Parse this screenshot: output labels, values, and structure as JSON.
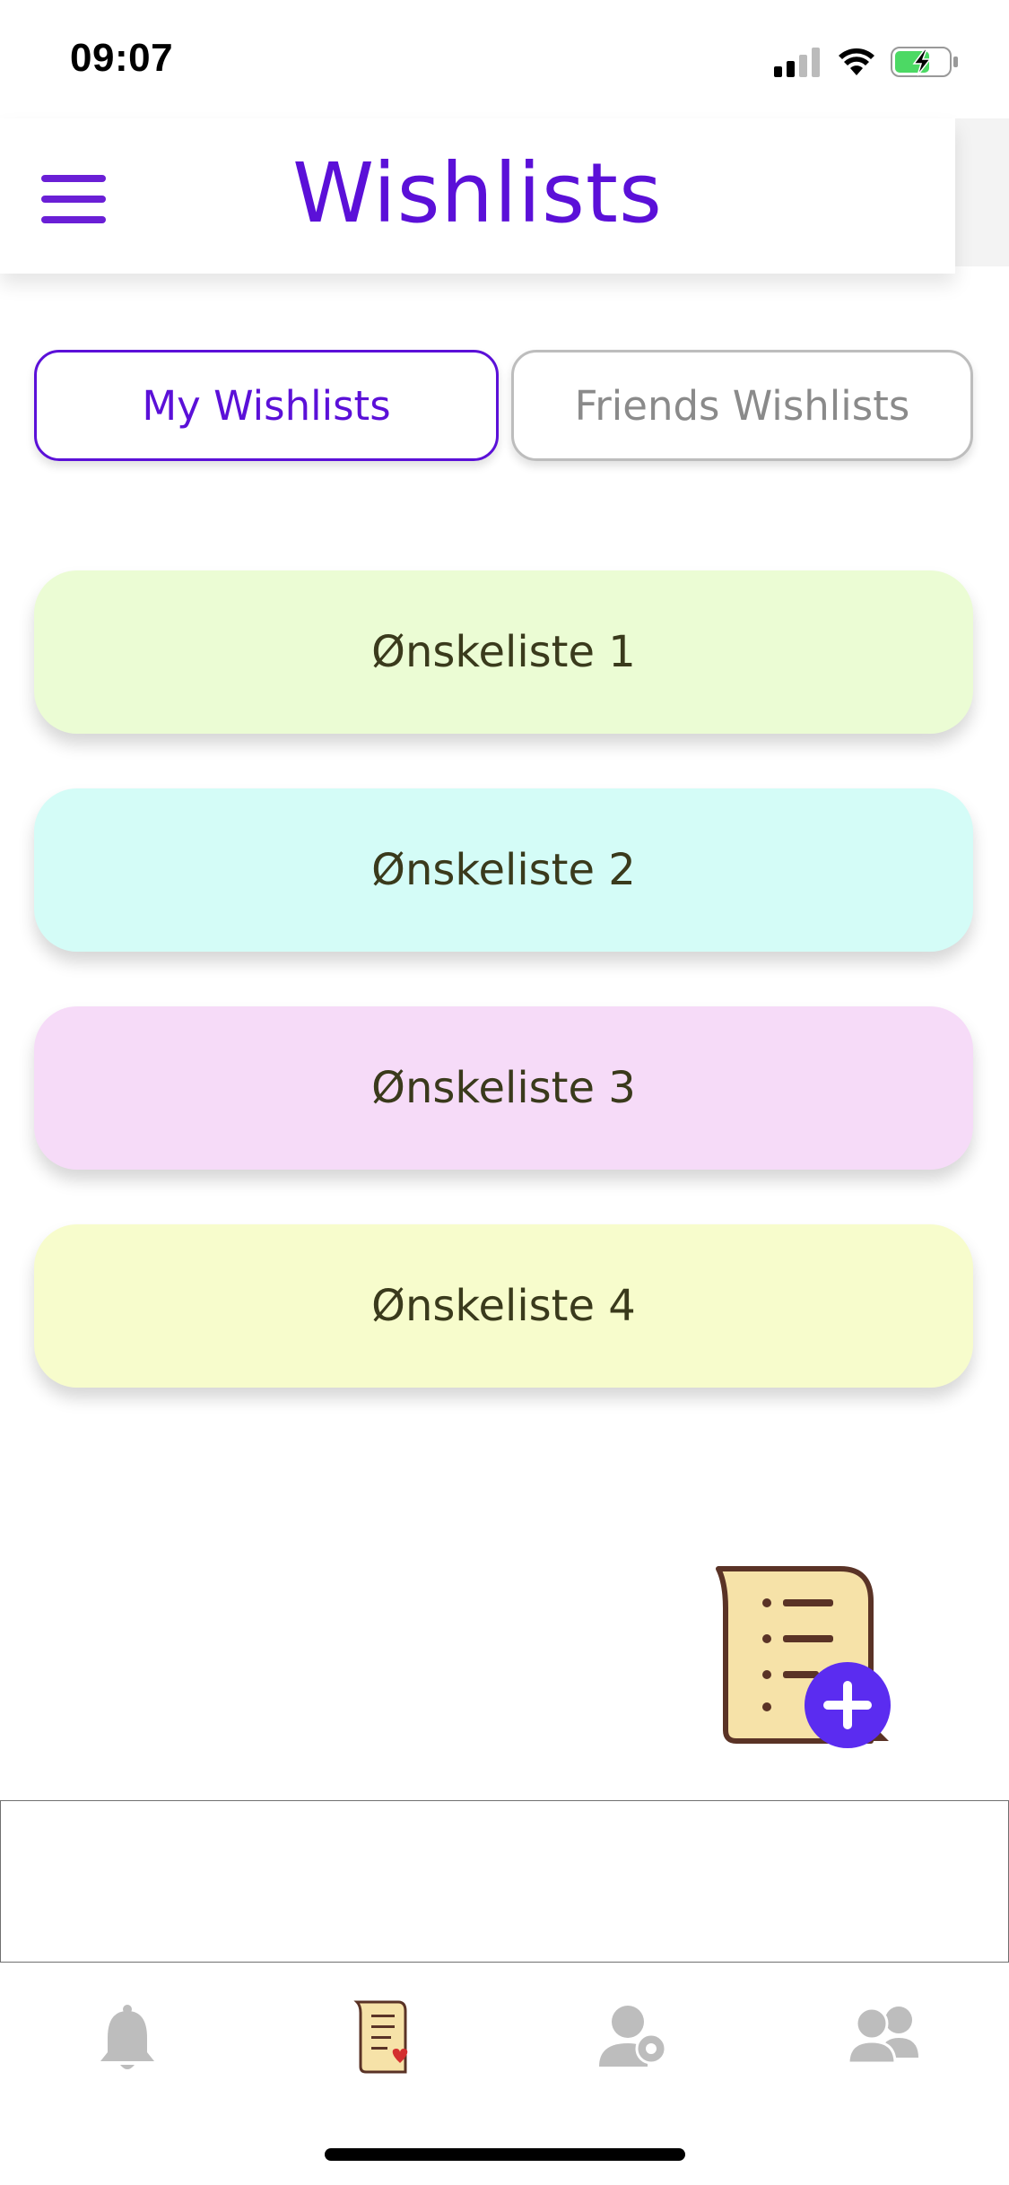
{
  "status_bar": {
    "time": "09:07"
  },
  "header": {
    "title": "Wishlists",
    "menu_icon": "hamburger-menu-icon"
  },
  "tabs": [
    {
      "label": "My Wishlists",
      "active": true
    },
    {
      "label": "Friends Wishlists",
      "active": false
    }
  ],
  "wishlists": [
    {
      "name": "Ønskeliste 1",
      "color": "#ebfcd4"
    },
    {
      "name": "Ønskeliste 2",
      "color": "#d4fcf7"
    },
    {
      "name": "Ønskeliste 3",
      "color": "#f6dbf8"
    },
    {
      "name": "Ønskeliste 4",
      "color": "#f7fccc"
    }
  ],
  "fab": {
    "icon": "scroll-add-icon"
  },
  "tab_bar": {
    "items": [
      {
        "icon": "bell-icon",
        "active": false
      },
      {
        "icon": "scroll-heart-icon",
        "active": true
      },
      {
        "icon": "user-settings-icon",
        "active": false
      },
      {
        "icon": "friends-icon",
        "active": false
      }
    ]
  },
  "colors": {
    "accent": "#5b10d8",
    "fab": "#5b2cf0",
    "inactive_icon": "#bdbdbd"
  }
}
